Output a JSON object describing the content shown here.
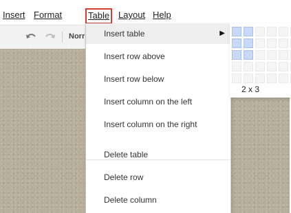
{
  "menubar": {
    "items": [
      {
        "label": "Insert"
      },
      {
        "label": "Format"
      },
      {
        "label": "Table",
        "active": true
      },
      {
        "label": "Layout"
      },
      {
        "label": "Help"
      }
    ]
  },
  "toolbar": {
    "undo_icon": "undo-icon",
    "redo_icon": "redo-icon",
    "style_label": "Norr"
  },
  "table_menu": {
    "items": [
      {
        "label": "Insert table",
        "highlighted": true,
        "submenu": true
      },
      {
        "label": "Insert row above"
      },
      {
        "label": "Insert row below"
      },
      {
        "label": "Insert column on the left"
      },
      {
        "label": "Insert column on the right"
      },
      {
        "label": "Delete table"
      },
      {
        "label": "Delete row"
      },
      {
        "label": "Delete column"
      }
    ]
  },
  "table_picker": {
    "selection_label": "2 x 3",
    "selected_columns": 2,
    "selected_rows": 3,
    "highlight_color": "#c7d9f6"
  },
  "colors": {
    "active_outline": "#d63b2f",
    "canvas": "#b7ae9b",
    "menu_hover": "#eeeeee"
  }
}
